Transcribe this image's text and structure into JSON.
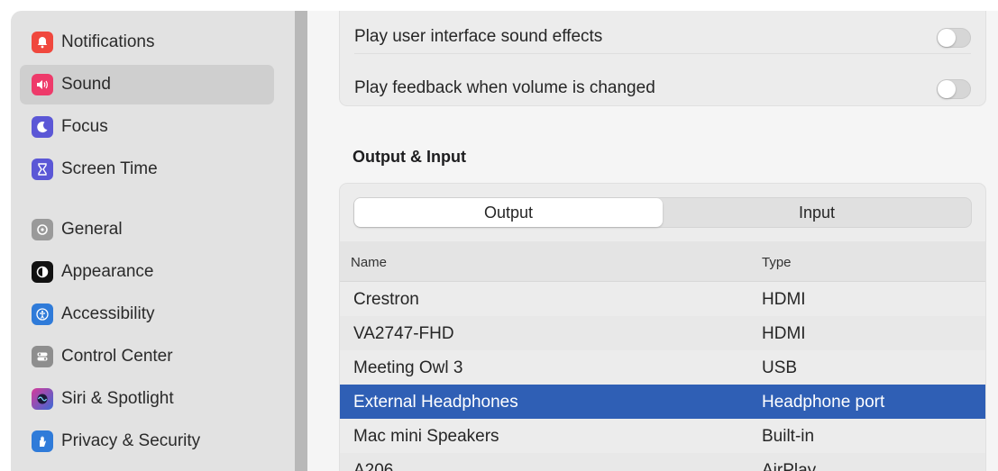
{
  "sidebar": {
    "items": [
      {
        "label": "Notifications",
        "icon": "bell-icon",
        "color": "#f0483e",
        "selected": false
      },
      {
        "label": "Sound",
        "icon": "speaker-icon",
        "color": "#ee3a6a",
        "selected": true
      },
      {
        "label": "Focus",
        "icon": "moon-icon",
        "color": "#5b57d6",
        "selected": false
      },
      {
        "label": "Screen Time",
        "icon": "hourglass-icon",
        "color": "#5b57d6",
        "selected": false
      },
      {
        "label": "General",
        "icon": "gear-icon",
        "color": "#9a9a9a",
        "selected": false
      },
      {
        "label": "Appearance",
        "icon": "appearance-icon",
        "color": "#111111",
        "selected": false
      },
      {
        "label": "Accessibility",
        "icon": "accessibility-icon",
        "color": "#2f7bd9",
        "selected": false
      },
      {
        "label": "Control Center",
        "icon": "control-center-icon",
        "color": "#8e8e8e",
        "selected": false
      },
      {
        "label": "Siri & Spotlight",
        "icon": "siri-icon",
        "color": "#7b3ad6",
        "selected": false
      },
      {
        "label": "Privacy & Security",
        "icon": "hand-icon",
        "color": "#2f7bd9",
        "selected": false
      }
    ]
  },
  "sound_effects": {
    "rows": [
      {
        "label": "Play user interface sound effects",
        "on": false
      },
      {
        "label": "Play feedback when volume is changed",
        "on": false
      }
    ]
  },
  "output_input": {
    "title": "Output & Input",
    "tabs": [
      {
        "label": "Output",
        "active": true
      },
      {
        "label": "Input",
        "active": false
      }
    ],
    "columns": {
      "name": "Name",
      "type": "Type"
    },
    "devices": [
      {
        "name": "Crestron",
        "type": "HDMI",
        "selected": false
      },
      {
        "name": "VA2747-FHD",
        "type": "HDMI",
        "selected": false
      },
      {
        "name": "Meeting Owl 3",
        "type": "USB",
        "selected": false
      },
      {
        "name": "External Headphones",
        "type": "Headphone port",
        "selected": true
      },
      {
        "name": "Mac mini Speakers",
        "type": "Built-in",
        "selected": false
      },
      {
        "name": "A206",
        "type": "AirPlay",
        "selected": false
      }
    ]
  },
  "colors": {
    "accent": "#2f5fb5",
    "sidebar_bg": "#e2e2e2",
    "sidebar_selected": "#cfcfcf"
  }
}
